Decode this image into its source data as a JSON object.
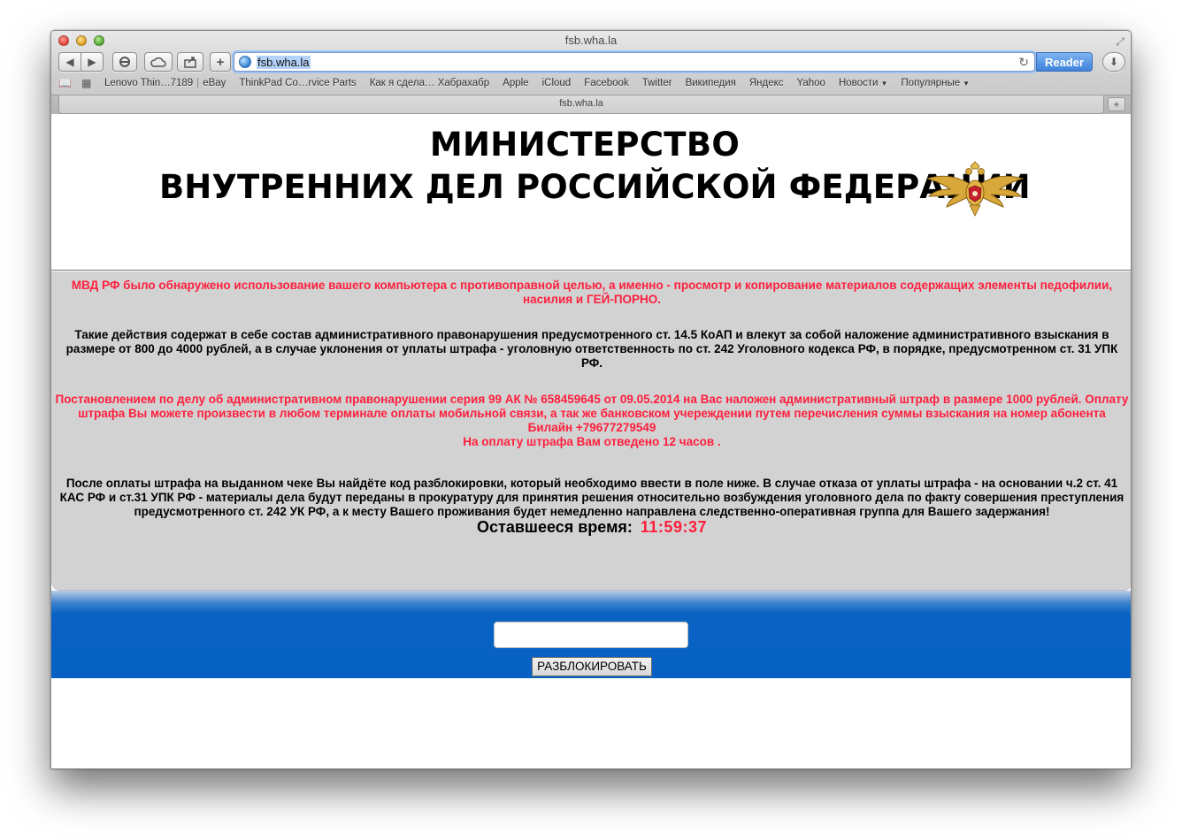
{
  "window": {
    "title": "fsb.wha.la"
  },
  "toolbar": {
    "url": "fsb.wha.la",
    "reader_label": "Reader",
    "add_label": "+"
  },
  "bookmarks": {
    "items": [
      "Lenovo Thin…7189",
      "eBay",
      "ThinkPad Co…rvice Parts",
      "Как я сдела… Хабрахабр",
      "Apple",
      "iCloud",
      "Facebook",
      "Twitter",
      "Википедия",
      "Яндекс",
      "Yahoo",
      "Новости",
      "Популярные"
    ]
  },
  "tab": {
    "title": "fsb.wha.la"
  },
  "page": {
    "heading_line1": "МИНИСТЕРСТВО",
    "heading_line2": "ВНУТРЕННИХ ДЕЛ РОССИЙСКОЙ ФЕДЕРАЦИИ",
    "para1": "МВД РФ было обнаружено использование вашего компьютера с противоправной целью, а именно - просмотр и копирование материалов содержащих элементы педофилии, насилия и ГЕЙ-ПОРНО.",
    "para2": "Такие действия содержат в себе состав административного правонарушения предусмотренного ст. 14.5 КоАП и влекут за собой наложение административного взыскания в размере от 800 до 4000 рублей, а в случае уклонения от уплаты штрафа - уголовную ответственность по ст. 242 Уголовного кодекса РФ, в порядке, предусмотренном ст. 31 УПК РФ.",
    "para3": "Постановлением по делу об административном правонарушении серия 99 АК № 658459645 от 09.05.2014 на Вас наложен административный штраф в размере 1000 рублей. Оплату штрафа Вы можете произвести в любом терминале оплаты мобильной связи, а так же банковском учереждении путем перечисления суммы взыскания на номер абонента Билайн +79677279549",
    "para3_deadline": "На оплату штрафа Вам отведено 12 часов .",
    "para4": "После оплаты штрафа на выданном чеке Вы найдёте код разблокировки, который необходимо ввести в поле ниже. В случае отказа от уплаты штрафа - на основании ч.2 ст. 41 КАС РФ и ст.31 УПК РФ - материалы дела будут переданы в прокуратуру для принятия решения относительно возбуждения уголовного дела по факту совершения преступления предусмотренного ст. 242 УК РФ, а к месту Вашего проживания будет немедленно направлена следственно-оперативная группа для Вашего задержания!",
    "timer_label": "Оставшееся время:",
    "timer_value": "11:59:37",
    "code_value": "",
    "unlock_label": "РАЗБЛОКИРОВАТЬ"
  },
  "colors": {
    "alert_red": "#ff1f3d",
    "panel_gray": "#d2d2d2",
    "band_blue": "#0761c4"
  }
}
